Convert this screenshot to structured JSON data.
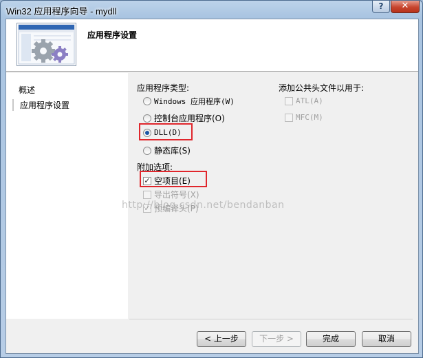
{
  "window": {
    "title": "Win32 应用程序向导 - mydll",
    "close_label": "✕",
    "help_label": "?"
  },
  "header": {
    "title": "应用程序设置"
  },
  "nav": {
    "items": [
      {
        "label": "概述"
      },
      {
        "label": "应用程序设置"
      }
    ]
  },
  "app_type": {
    "label": "应用程序类型:",
    "options": [
      {
        "label": "Windows 应用程序(W)",
        "selected": false
      },
      {
        "label": "控制台应用程序(O)",
        "selected": false
      },
      {
        "label": "DLL(D)",
        "selected": true
      },
      {
        "label": "静态库(S)",
        "selected": false
      }
    ]
  },
  "extra_options": {
    "label": "附加选项:",
    "items": [
      {
        "label": "空项目(E)",
        "checked": true,
        "enabled": true
      },
      {
        "label": "导出符号(X)",
        "checked": false,
        "enabled": false
      },
      {
        "label": "预编译头(P)",
        "checked": true,
        "enabled": false
      }
    ]
  },
  "common_headers": {
    "label": "添加公共头文件以用于:",
    "items": [
      {
        "label": "ATL(A)",
        "checked": false,
        "enabled": false
      },
      {
        "label": "MFC(M)",
        "checked": false,
        "enabled": false
      }
    ]
  },
  "watermark": "http://blog.csdn.net/bendanban",
  "buttons": {
    "prev": "< 上一步",
    "next": "下一步 >",
    "finish": "完成",
    "cancel": "取消"
  },
  "colors": {
    "highlight_box": "#e0262c",
    "radio_selected": "#1a55a6"
  }
}
